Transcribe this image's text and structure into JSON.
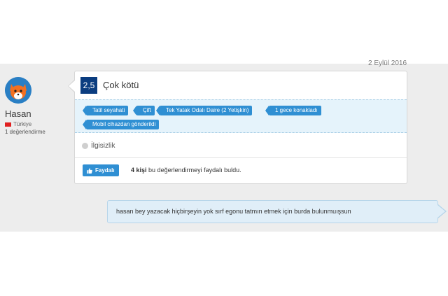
{
  "review": {
    "date": "2 Eylül 2016",
    "user": {
      "name": "Hasan",
      "country": "Türkiye",
      "review_count": "1 değerlendirme"
    },
    "score": "2,5",
    "rating_text": "Çok kötü",
    "tags": [
      "Tatil seyahati",
      "Çift",
      "Tek Yatak Odalı Daire (2 Yetişkin)",
      "1 gece konakladı",
      "Mobil cihazdan gönderildi"
    ],
    "relevance_label": "İlgisizlik",
    "helpful": {
      "button_label": "Faydalı",
      "count_text": "4 kişi",
      "suffix_text": "bu değerlendirmeyi faydalı buldu."
    }
  },
  "comment": {
    "text": "hasan bey yazacak hiçbirşeyin yok sırf egonu tatmın etmek için burda bulunmuışsun"
  },
  "colors": {
    "score_bg": "#0b3d80",
    "tag_bg": "#2f8fd3",
    "tags_band": "#e5f3fb",
    "comment_bg": "#e0eef8"
  },
  "icons": [
    "fox-avatar",
    "turkey-flag-icon",
    "circle-icon",
    "thumbs-up-icon"
  ]
}
